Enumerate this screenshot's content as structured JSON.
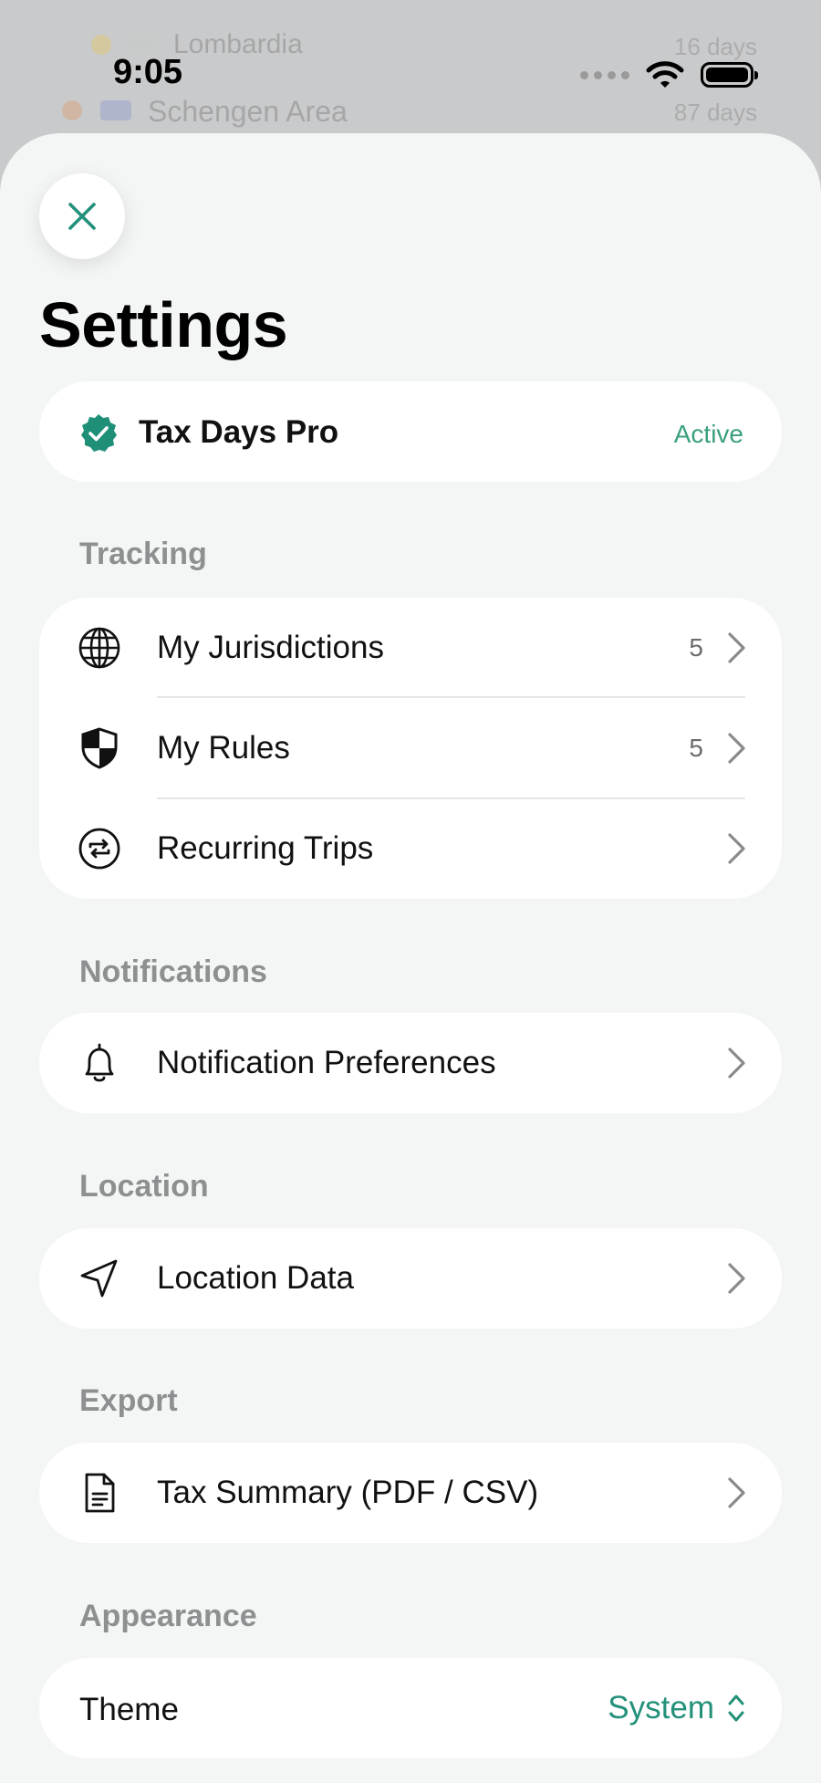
{
  "background": {
    "rows": [
      {
        "label": "Lombardia",
        "value": "16 days"
      },
      {
        "label": "Schengen Area",
        "value": "87 days"
      }
    ]
  },
  "status_bar": {
    "time": "9:05"
  },
  "header": {
    "title": "Settings",
    "close_icon": "close-icon"
  },
  "pro": {
    "name": "Tax Days Pro",
    "status": "Active",
    "badge_color": "#1f8f78"
  },
  "sections": {
    "tracking": {
      "title": "Tracking",
      "items": [
        {
          "label": "My Jurisdictions",
          "count": "5",
          "icon": "globe-icon"
        },
        {
          "label": "My Rules",
          "count": "5",
          "icon": "shield-icon"
        },
        {
          "label": "Recurring Trips",
          "count": "",
          "icon": "repeat-icon"
        }
      ]
    },
    "notifications": {
      "title": "Notifications",
      "items": [
        {
          "label": "Notification Preferences",
          "icon": "bell-icon"
        }
      ]
    },
    "location": {
      "title": "Location",
      "items": [
        {
          "label": "Location Data",
          "icon": "location-arrow-icon"
        }
      ]
    },
    "export": {
      "title": "Export",
      "items": [
        {
          "label": "Tax Summary (PDF / CSV)",
          "icon": "document-icon"
        }
      ]
    },
    "appearance": {
      "title": "Appearance",
      "theme_label": "Theme",
      "theme_value": "System"
    }
  },
  "colors": {
    "accent": "#23917a",
    "active_text": "#3aa07f",
    "section_title": "#8d9091",
    "sheet_bg": "#f4f5f5"
  }
}
